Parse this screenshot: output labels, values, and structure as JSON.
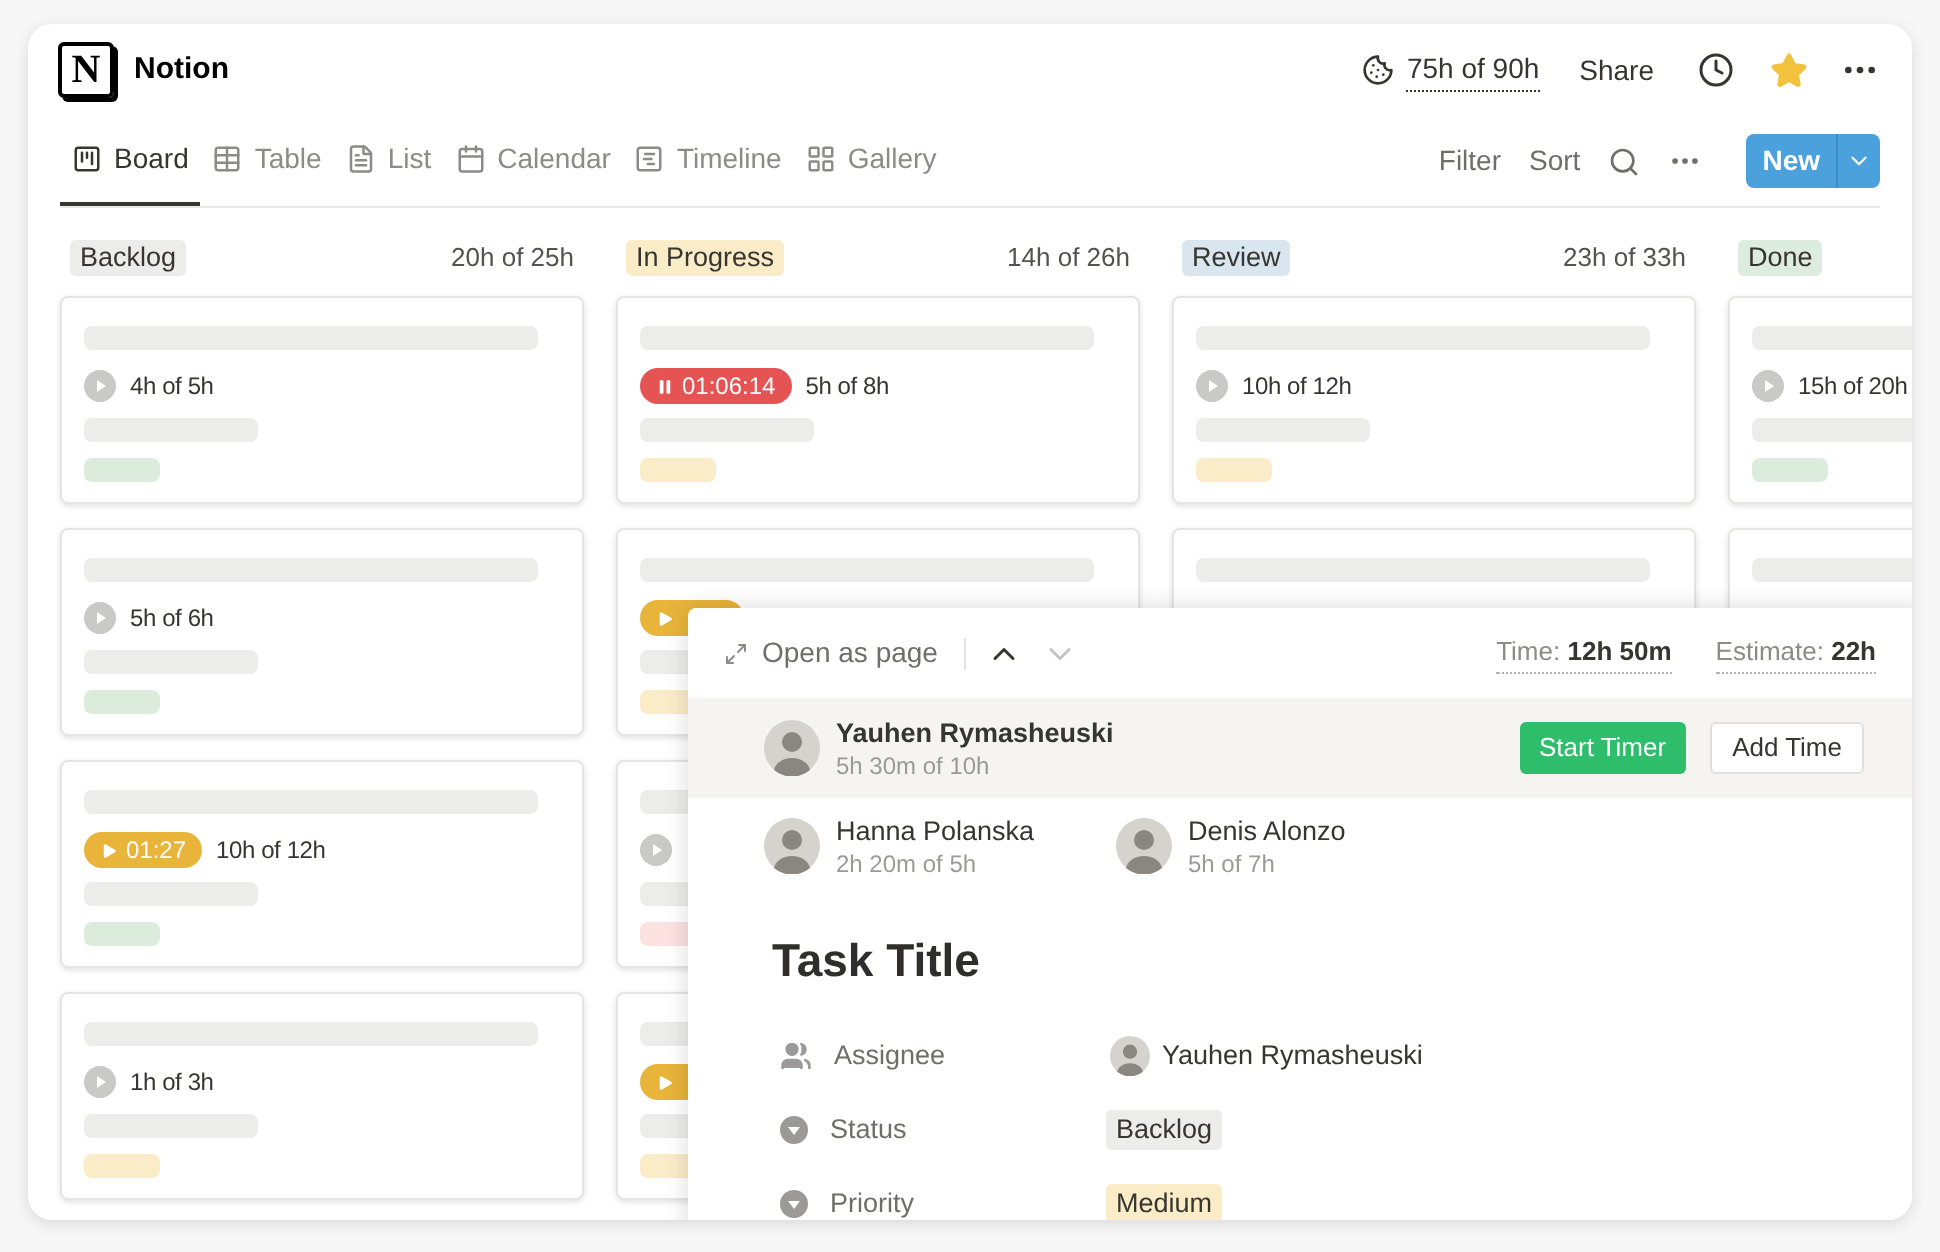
{
  "app": {
    "logo": "N",
    "title": "Notion",
    "time_budget": "75h of 90h",
    "share": "Share",
    "favorite": true
  },
  "tabs": [
    {
      "label": "Board",
      "kind": "board",
      "selected": true
    },
    {
      "label": "Table",
      "kind": "table",
      "selected": false
    },
    {
      "label": "List",
      "kind": "list",
      "selected": false
    },
    {
      "label": "Calendar",
      "kind": "calendar",
      "selected": false
    },
    {
      "label": "Timeline",
      "kind": "timeline",
      "selected": false
    },
    {
      "label": "Gallery",
      "kind": "gallery",
      "selected": false
    }
  ],
  "toolbar": {
    "filter": "Filter",
    "sort": "Sort",
    "new": "New"
  },
  "columns": [
    {
      "name": "Backlog",
      "color": "#ececeb",
      "total": "20h of 25h",
      "cards": [
        {
          "kind": "task",
          "timer": {
            "kind": "idle"
          },
          "progress": "4h of 5h",
          "color": "#dcecdc"
        },
        {
          "kind": "task",
          "timer": {
            "kind": "idle"
          },
          "progress": "5h of 6h",
          "color": "#dcecdc"
        },
        {
          "kind": "task",
          "timer": {
            "kind": "running",
            "time": "01:27"
          },
          "progress": "10h of 12h",
          "color": "#dcecdc"
        },
        {
          "kind": "task",
          "timer": {
            "kind": "idle"
          },
          "progress": "1h of 3h",
          "color": "#fbecc8"
        }
      ]
    },
    {
      "name": "In Progress",
      "color": "#fbecc8",
      "total": "14h of 26h",
      "cards": [
        {
          "kind": "task",
          "timer": {
            "kind": "paused",
            "time": "01:06:14"
          },
          "progress": "5h of 8h",
          "color": "#fbecc8"
        },
        {
          "kind": "task",
          "timer": {
            "kind": "running"
          },
          "color": "#fbecc8"
        },
        {
          "kind": "task",
          "timer": {
            "kind": "idle"
          },
          "color": "#fbe2e0"
        },
        {
          "kind": "task",
          "timer": {
            "kind": "running"
          },
          "color": "#fbecc8"
        }
      ]
    },
    {
      "name": "Review",
      "color": "#d9e5ef",
      "total": "23h of 33h",
      "cards": [
        {
          "kind": "task",
          "timer": {
            "kind": "idle"
          },
          "progress": "10h of 12h",
          "color": "#fbecc8"
        },
        {
          "kind": "task"
        }
      ]
    },
    {
      "name": "Done",
      "color": "#dcecdf",
      "cards": [
        {
          "kind": "task",
          "timer": {
            "kind": "idle"
          },
          "progress": "15h of 20h",
          "color": "#dcecdc"
        },
        {
          "kind": "task"
        }
      ]
    }
  ],
  "panel": {
    "open_as_page": "Open as page",
    "navigation": [
      {
        "kind": "up",
        "disabled": false
      },
      {
        "kind": "down",
        "disabled": true
      }
    ],
    "time_label": "Time:",
    "time": "12h 50m",
    "estimate_label": "Estimate:",
    "estimate": "22h",
    "current": {
      "name": "Yauhen Rymasheuski",
      "time": "5h 30m of 10h",
      "start": "Start Timer",
      "add": "Add Time"
    },
    "others": [
      {
        "name": "Hanna Polanska",
        "time": "2h 20m of 5h"
      },
      {
        "name": "Denis Alonzo",
        "time": "5h of 7h"
      }
    ],
    "title": "Task Title",
    "properties": [
      {
        "kind": "person",
        "label": "Assignee",
        "value": "Yauhen Rymasheuski"
      },
      {
        "kind": "select",
        "label": "Status",
        "value": "Backlog",
        "color": "#ececeb"
      },
      {
        "kind": "select",
        "label": "Priority",
        "value": "Medium",
        "color": "#fbecc8"
      }
    ]
  }
}
